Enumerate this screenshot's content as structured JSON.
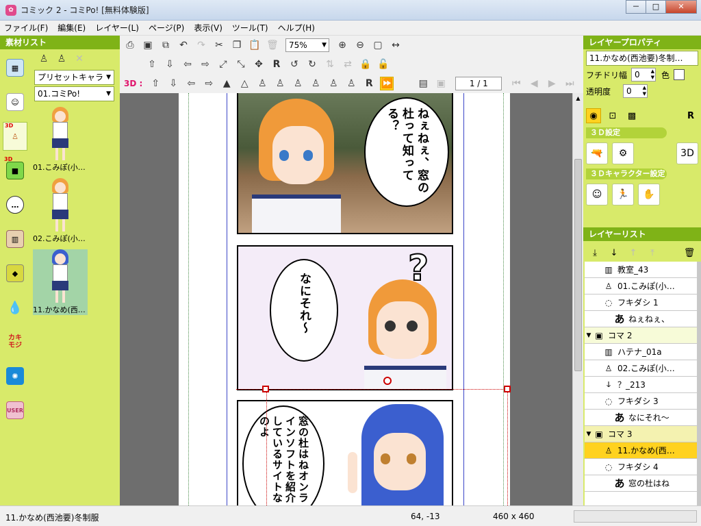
{
  "window": {
    "title": "コミック 2 - コミPo! [無料体験版]",
    "min": "－",
    "max": "□",
    "close": "✕"
  },
  "menu": [
    "ファイル(F)",
    "編集(E)",
    "レイヤー(L)",
    "ページ(P)",
    "表示(V)",
    "ツール(T)",
    "ヘルプ(H)"
  ],
  "materials": {
    "title": "素材リスト",
    "preset": "プリセットキャラ",
    "character": "01.コミPo!",
    "badge_3d": "3D",
    "items": [
      {
        "label": "01.こみぽ(小…",
        "hair": "#f0a040"
      },
      {
        "label": "02.こみぽ(小…",
        "hair": "#f0a040"
      },
      {
        "label": "11.かなめ(西…",
        "hair": "#3b5fcf"
      }
    ],
    "kakimoji": "カキモジ",
    "user": "USER"
  },
  "toolbar": {
    "zoom": "75%",
    "label_3d": "3D :",
    "page": "1 / 1"
  },
  "canvas": {
    "panel1_text": "ねぇねぇ、窓の杜って知ってる？",
    "panel2_text": "なにそれ～",
    "panel3_text": "窓の杜はねオンラインソフトを紹介しているサイトなのよ",
    "question": "?"
  },
  "properties": {
    "title": "レイヤープロパティ",
    "layer_name": "11.かなめ(西池要)冬制…",
    "outline_label": "フチドリ幅",
    "outline_value": "0",
    "color_label": "色",
    "opacity_label": "透明度",
    "opacity_value": "0",
    "r_label": "R",
    "section_3d": "３Ｄ設定",
    "section_3d_char": "３Ｄキャラクター設定"
  },
  "layers": {
    "title": "レイヤーリスト",
    "rows": [
      {
        "label": "教室_43"
      },
      {
        "label": "01.こみぽ(小…"
      },
      {
        "label": "フキダシ 1"
      },
      {
        "label": "ねぇねぇ、"
      },
      {
        "label": "コマ 2"
      },
      {
        "label": "ハテナ_01a"
      },
      {
        "label": "02.こみぽ(小…"
      },
      {
        "label": "？_213"
      },
      {
        "label": "フキダシ 3"
      },
      {
        "label": "なにそれ～"
      },
      {
        "label": "コマ 3"
      },
      {
        "label": "11.かなめ(西…"
      },
      {
        "label": "フキダシ 4"
      },
      {
        "label": "窓の杜はね"
      }
    ],
    "text_glyph": "あ"
  },
  "status": {
    "name": "11.かなめ(西池要)冬制服",
    "coords": "64, -13",
    "size": "460 x 460"
  },
  "colors": {
    "green_head": "#7fb317",
    "panel_bg": "#d8ea6a",
    "selection": "#ffd21f"
  }
}
